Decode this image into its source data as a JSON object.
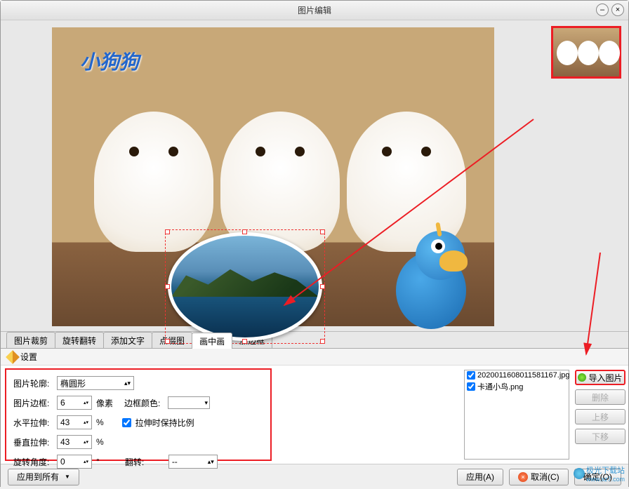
{
  "window": {
    "title": "图片编辑"
  },
  "overlay_text": "小狗狗",
  "tabs": {
    "t0": "图片裁剪",
    "t1": "旋转翻转",
    "t2": "添加文字",
    "t3": "点缀图",
    "t4": "画中画",
    "t5": "加边框"
  },
  "settings": {
    "header": "设置",
    "outline_label": "图片轮廓:",
    "outline_value": "椭圆形",
    "border_label": "图片边框:",
    "border_value": "6",
    "pixel_unit": "像素",
    "border_color_label": "边框颜色:",
    "hstretch_label": "水平拉伸:",
    "hstretch_value": "43",
    "vstretch_label": "垂直拉伸:",
    "vstretch_value": "43",
    "percent": "%",
    "keep_ratio_label": "拉伸时保持比例",
    "angle_label": "旋转角度:",
    "angle_value": "0",
    "degree": "°",
    "flip_label": "翻转:",
    "flip_value": "--"
  },
  "files": {
    "f0": "2020011608011581167.jpg",
    "f1": "卡通小鸟.png"
  },
  "buttons": {
    "import": "导入图片",
    "delete": "删除",
    "up": "上移",
    "down": "下移",
    "apply_all": "应用到所有",
    "apply": "应用(A)",
    "cancel": "取消(C)",
    "ok": "确定(O)"
  },
  "watermark": {
    "name": "极光下载站",
    "url": "www.xz7.com"
  }
}
